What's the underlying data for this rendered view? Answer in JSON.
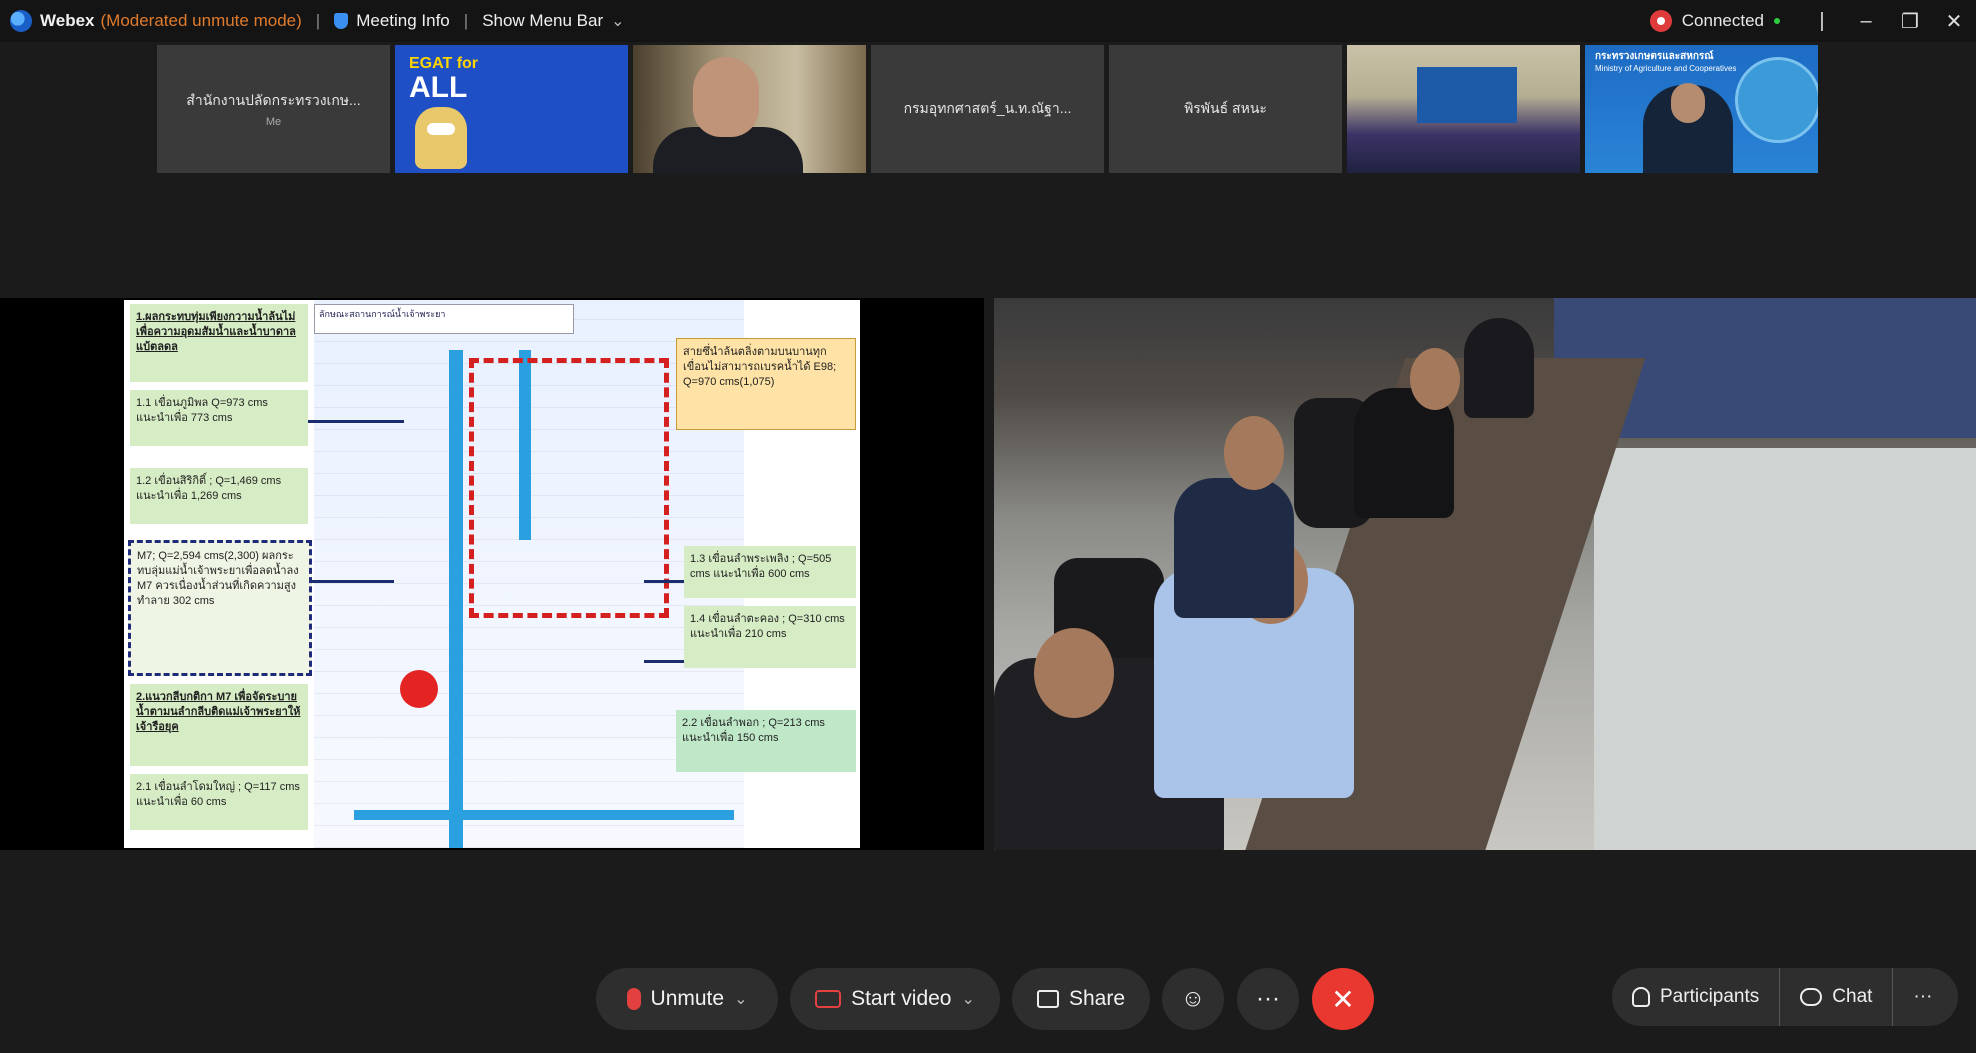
{
  "titlebar": {
    "app": "Webex",
    "mode": "(Moderated unmute mode)",
    "separator": "|",
    "meeting_info": "Meeting Info",
    "menu_bar": "Show Menu Bar",
    "connection_status": "Connected",
    "window_buttons": [
      "–",
      "❐",
      "✕"
    ]
  },
  "participants": [
    {
      "name": "สำนักงานปลัดกระทรวงเกษ...",
      "sub": "Me",
      "type": "name"
    },
    {
      "name": "EGAT for ALL",
      "type": "logo"
    },
    {
      "name": "",
      "type": "camera"
    },
    {
      "name": "กรมอุทกศาสตร์_น.ท.ณัฐา...",
      "type": "name"
    },
    {
      "name": "พิรพันธ์ สหนะ",
      "type": "name"
    },
    {
      "name": "",
      "type": "room"
    },
    {
      "name": "กระทรวงเกษตรและสหกรณ์",
      "sub": "Ministry of Agriculture and Cooperatives",
      "type": "ministry"
    }
  ],
  "egat": {
    "line1": "EGAT for",
    "line2": "ALL"
  },
  "slide": {
    "header": "ลักษณะสถานการณ์น้ำเจ้าพระยา",
    "notes": {
      "n1": "1.ผลกระทบทุ่มเพียงกวามน้ำล้นไม่เพื่อความอุดมสัมน้ำและน้ำบาดาลแบ้ตลดล",
      "n2": "1.1 เขื่อนภูมิพล Q=973 cms แนะนำเพื่อ 773 cms",
      "n3": "1.2 เขื่อนสิริกิติ์ ; Q=1,469 cms แนะนำเพื่อ 1,269 cms",
      "n4": "M7; Q=2,594 cms(2,300) ผลกระทบลุ่มแม่น้ำเจ้าพระยาเพื่อลดน้ำลง M7 ควรเนื่องน้ำส่วนที่เกิดความสูง ทำลาย 302 cms",
      "n5": "2.แนวกลีบกติกา M7 เพื่อจัดระบายน้ำตามนลำกลีบติดแม่เจ้าพระยาให้เจ้ารือยุค",
      "n6": "2.1 เขื่อนลำโดมใหญ่ ; Q=117 cms แนะนำเพื่อ 60 cms",
      "n7": "สายซึ่นำล้นตลิ่งตามบนบานทุกเขื่อนไม่สามารถเบรคน้ำได้ E98; Q=970 cms(1,075)",
      "n8": "1.3 เขื่อนลำพระเพลิง ; Q=505 cms แนะนำเพื่อ 600 cms",
      "n9": "1.4 เขื่อนลำตะคอง ; Q=310 cms แนะนำเพื่อ 210 cms",
      "n10": "2.2 เขื่อนลำพอก ; Q=213 cms แนะนำเพื่อ 150 cms"
    }
  },
  "controls": {
    "unmute": "Unmute",
    "start_video": "Start video",
    "share": "Share",
    "reactions_icon": "☺",
    "more": "···",
    "end": "✕",
    "participants": "Participants",
    "chat": "Chat",
    "more_right": "···",
    "dropdown": "⌄"
  },
  "colors": {
    "accent_orange": "#e07b2c",
    "end_red": "#e8382f",
    "mic_red": "#e34040",
    "connected_green": "#2ecc40"
  }
}
